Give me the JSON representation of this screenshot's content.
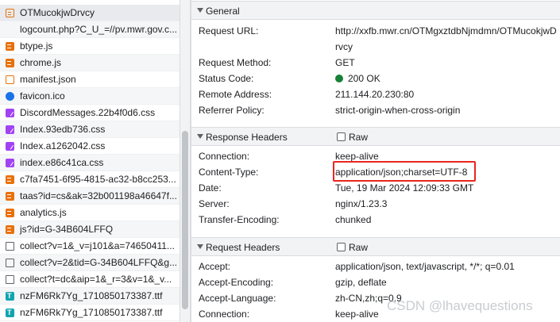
{
  "requests": [
    {
      "name": "OTMucokjwDrvcy",
      "icon": "xhr-icon",
      "selected": true
    },
    {
      "name": "logcount.php?C_U_=//pv.mwr.gov.c...",
      "icon": "none",
      "indent": true
    },
    {
      "name": "btype.js",
      "icon": "js-icon"
    },
    {
      "name": "chrome.js",
      "icon": "js-icon"
    },
    {
      "name": "manifest.json",
      "icon": "bracket-icon"
    },
    {
      "name": "favicon.ico",
      "icon": "ico-icon"
    },
    {
      "name": "DiscordMessages.22b4f0d6.css",
      "icon": "css-icon"
    },
    {
      "name": "Index.93edb736.css",
      "icon": "css-icon"
    },
    {
      "name": "Index.a1262042.css",
      "icon": "css-icon"
    },
    {
      "name": "index.e86c41ca.css",
      "icon": "css-icon"
    },
    {
      "name": "c7fa7451-6f95-4815-ac32-b8cc253...",
      "icon": "js-icon"
    },
    {
      "name": "taas?id=cs&ak=32b001198a46647f...",
      "icon": "js-icon"
    },
    {
      "name": "analytics.js",
      "icon": "js-icon"
    },
    {
      "name": "js?id=G-34B604LFFQ",
      "icon": "js-icon"
    },
    {
      "name": "collect?v=1&_v=j101&a=74650411...",
      "icon": "doc-icon"
    },
    {
      "name": "collect?v=2&tid=G-34B604LFFQ&g...",
      "icon": "doc-icon"
    },
    {
      "name": "collect?t=dc&aip=1&_r=3&v=1&_v...",
      "icon": "doc-icon"
    },
    {
      "name": "nzFM6Rk7Yg_1710850173387.ttf",
      "icon": "font-icon"
    },
    {
      "name": "nzFM6Rk7Yg_1710850173387.ttf",
      "icon": "font-icon"
    }
  ],
  "general": {
    "title": "General",
    "rows": [
      {
        "key": "Request URL:",
        "value": "http://xxfb.mwr.cn/OTMgxztdbNjmdmn/OTMucokjwD"
      },
      {
        "key": "",
        "value": "rvcy"
      },
      {
        "key": "Request Method:",
        "value": "GET"
      },
      {
        "key": "Status Code:",
        "value": "200 OK",
        "status": true
      },
      {
        "key": "Remote Address:",
        "value": "211.144.20.230:80"
      },
      {
        "key": "Referrer Policy:",
        "value": "strict-origin-when-cross-origin"
      }
    ]
  },
  "response_headers": {
    "title": "Response Headers",
    "raw_label": "Raw",
    "rows": [
      {
        "key": "Connection:",
        "value": "keep-alive"
      },
      {
        "key": "Content-Type:",
        "value": "application/json;charset=UTF-8"
      },
      {
        "key": "Date:",
        "value": "Tue, 19 Mar 2024 12:09:33 GMT"
      },
      {
        "key": "Server:",
        "value": "nginx/1.23.3"
      },
      {
        "key": "Transfer-Encoding:",
        "value": "chunked"
      }
    ]
  },
  "request_headers": {
    "title": "Request Headers",
    "raw_label": "Raw",
    "rows": [
      {
        "key": "Accept:",
        "value": "application/json, text/javascript, */*; q=0.01"
      },
      {
        "key": "Accept-Encoding:",
        "value": "gzip, deflate"
      },
      {
        "key": "Accept-Language:",
        "value": "zh-CN,zh;q=0.9"
      },
      {
        "key": "Connection:",
        "value": "keep-alive"
      }
    ]
  },
  "watermark": "CSDN @lhavequestions",
  "colors": {
    "status_ok": "#188038",
    "highlight": "#e8261e"
  }
}
